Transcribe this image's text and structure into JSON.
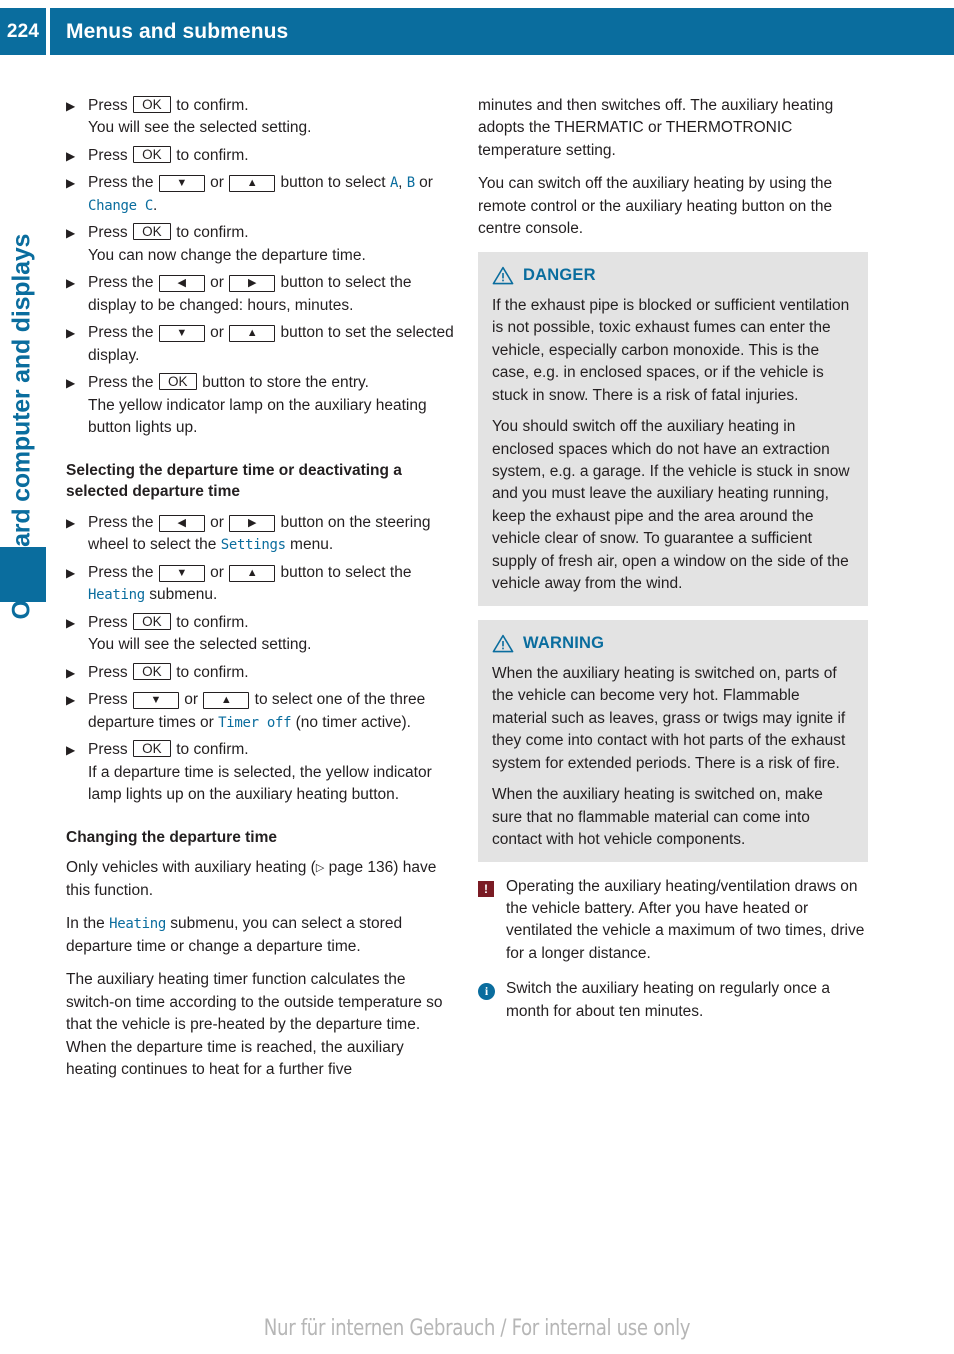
{
  "header": {
    "page_number": "224",
    "chapter_title": "Menus and submenus",
    "accent_color": "#0a6d9e"
  },
  "side_rail": {
    "chapter_label": "On-board computer and displays"
  },
  "footer": {
    "watermark": "Nur für internen Gebrauch / For internal use only"
  },
  "icons": {
    "ok_key": "OK",
    "arrow_down": "▼",
    "arrow_up": "▲",
    "arrow_left": "◀",
    "arrow_right": "▶",
    "step_bullet": "▶",
    "xref_triangle": "▷",
    "exclamation": "!",
    "info": "i"
  },
  "left_column": {
    "steps_top": [
      {
        "parts": [
          {
            "type": "text",
            "value": "Press "
          },
          {
            "type": "key",
            "value": "OK"
          },
          {
            "type": "text",
            "value": " to confirm."
          }
        ],
        "result": "You will see the selected setting."
      },
      {
        "parts": [
          {
            "type": "text",
            "value": "Press "
          },
          {
            "type": "key",
            "value": "OK"
          },
          {
            "type": "text",
            "value": " to confirm."
          }
        ],
        "result": ""
      },
      {
        "parts": [
          {
            "type": "text",
            "value": "Press the "
          },
          {
            "type": "key",
            "value": "▼"
          },
          {
            "type": "text",
            "value": " or "
          },
          {
            "type": "key",
            "value": "▲"
          },
          {
            "type": "text",
            "value": " button to select "
          },
          {
            "type": "disp",
            "value": "A"
          },
          {
            "type": "text",
            "value": ", "
          },
          {
            "type": "disp",
            "value": "B"
          },
          {
            "type": "text",
            "value": " or "
          },
          {
            "type": "disp",
            "value": "Change C"
          },
          {
            "type": "text",
            "value": "."
          }
        ],
        "result": ""
      },
      {
        "parts": [
          {
            "type": "text",
            "value": "Press "
          },
          {
            "type": "key",
            "value": "OK"
          },
          {
            "type": "text",
            "value": " to confirm."
          }
        ],
        "result": "You can now change the departure time."
      },
      {
        "parts": [
          {
            "type": "text",
            "value": "Press the "
          },
          {
            "type": "key",
            "value": "◀"
          },
          {
            "type": "text",
            "value": " or "
          },
          {
            "type": "key",
            "value": "▶"
          },
          {
            "type": "text",
            "value": " button to select the display to be changed: hours, minutes."
          }
        ],
        "result": ""
      },
      {
        "parts": [
          {
            "type": "text",
            "value": "Press the "
          },
          {
            "type": "key",
            "value": "▼"
          },
          {
            "type": "text",
            "value": " or "
          },
          {
            "type": "key",
            "value": "▲"
          },
          {
            "type": "text",
            "value": " button to set the selected display."
          }
        ],
        "result": ""
      },
      {
        "parts": [
          {
            "type": "text",
            "value": "Press the "
          },
          {
            "type": "key",
            "value": "OK"
          },
          {
            "type": "text",
            "value": " button to store the entry."
          }
        ],
        "result": "The yellow indicator lamp on the auxiliary heating button lights up."
      }
    ],
    "subhead_1": "Selecting the departure time or deactivating a selected departure time",
    "steps_mid": [
      {
        "parts": [
          {
            "type": "text",
            "value": "Press the "
          },
          {
            "type": "key",
            "value": "◀"
          },
          {
            "type": "text",
            "value": " or "
          },
          {
            "type": "key",
            "value": "▶"
          },
          {
            "type": "text",
            "value": " button on the steering wheel to select the "
          },
          {
            "type": "disp",
            "value": "Settings"
          },
          {
            "type": "text",
            "value": " menu."
          }
        ],
        "result": ""
      },
      {
        "parts": [
          {
            "type": "text",
            "value": "Press the "
          },
          {
            "type": "key",
            "value": "▼"
          },
          {
            "type": "text",
            "value": " or "
          },
          {
            "type": "key",
            "value": "▲"
          },
          {
            "type": "text",
            "value": " button to select the "
          },
          {
            "type": "disp",
            "value": "Heating"
          },
          {
            "type": "text",
            "value": " submenu."
          }
        ],
        "result": ""
      },
      {
        "parts": [
          {
            "type": "text",
            "value": "Press "
          },
          {
            "type": "key",
            "value": "OK"
          },
          {
            "type": "text",
            "value": " to confirm."
          }
        ],
        "result": "You will see the selected setting."
      },
      {
        "parts": [
          {
            "type": "text",
            "value": "Press "
          },
          {
            "type": "key",
            "value": "OK"
          },
          {
            "type": "text",
            "value": " to confirm."
          }
        ],
        "result": ""
      },
      {
        "parts": [
          {
            "type": "text",
            "value": "Press "
          },
          {
            "type": "key",
            "value": "▼"
          },
          {
            "type": "text",
            "value": " or "
          },
          {
            "type": "key",
            "value": "▲"
          },
          {
            "type": "text",
            "value": " to select one of the three departure times or "
          },
          {
            "type": "disp",
            "value": "Timer off"
          },
          {
            "type": "text",
            "value": " (no timer active)."
          }
        ],
        "result": ""
      },
      {
        "parts": [
          {
            "type": "text",
            "value": "Press "
          },
          {
            "type": "key",
            "value": "OK"
          },
          {
            "type": "text",
            "value": " to confirm."
          }
        ],
        "result": "If a departure time is selected, the yellow indicator lamp lights up on the auxiliary heating button."
      }
    ],
    "subhead_2": "Changing the departure time",
    "paragraphs": [
      {
        "parts": [
          {
            "type": "text",
            "value": "Only vehicles with auxiliary heating ("
          },
          {
            "type": "xref",
            "value": "▷"
          },
          {
            "type": "text",
            "value": " page 136) have this function."
          }
        ]
      },
      {
        "parts": [
          {
            "type": "text",
            "value": "In the "
          },
          {
            "type": "disp",
            "value": "Heating"
          },
          {
            "type": "text",
            "value": " submenu, you can select a stored departure time or change a departure time."
          }
        ]
      },
      {
        "parts": [
          {
            "type": "text",
            "value": "The auxiliary heating timer function calculates the switch-on time according to the outside temperature so that the vehicle is pre-heated by the departure time. When the departure time is reached, the auxiliary heating continues to heat for a further five"
          }
        ]
      }
    ]
  },
  "right_column": {
    "paragraphs": [
      "minutes and then switches off. The auxiliary heating adopts the THERMATIC or THERMOTRONIC temperature setting.",
      "You can switch off the auxiliary heating by using the remote control or the auxiliary heating button on the centre console."
    ],
    "notices": [
      {
        "label": "DANGER",
        "paragraphs": [
          "If the exhaust pipe is blocked or sufficient ventilation is not possible, toxic exhaust fumes can enter the vehicle, especially carbon monoxide. This is the case, e.g. in enclosed spaces, or if the vehicle is stuck in snow. There is a risk of fatal injuries.",
          "You should switch off the auxiliary heating in enclosed spaces which do not have an extraction system, e.g. a garage. If the vehicle is stuck in snow and you must leave the auxiliary heating running, keep the exhaust pipe and the area around the vehicle clear of snow. To guarantee a sufficient supply of fresh air, open a window on the side of the vehicle away from the wind."
        ]
      },
      {
        "label": "WARNING",
        "paragraphs": [
          "When the auxiliary heating is switched on, parts of the vehicle can become very hot. Flammable material such as leaves, grass or twigs may ignite if they come into contact with hot parts of the exhaust system for extended periods. There is a risk of fire.",
          "When the auxiliary heating is switched on, make sure that no flammable material can come into contact with hot vehicle components."
        ]
      }
    ],
    "notes": [
      {
        "icon": "exclamation",
        "text": "Operating the auxiliary heating/ventilation draws on the vehicle battery. After you have heated or ventilated the vehicle a maximum of two times, drive for a longer distance."
      },
      {
        "icon": "info",
        "text": "Switch the auxiliary heating on regularly once a month for about ten minutes."
      }
    ]
  }
}
